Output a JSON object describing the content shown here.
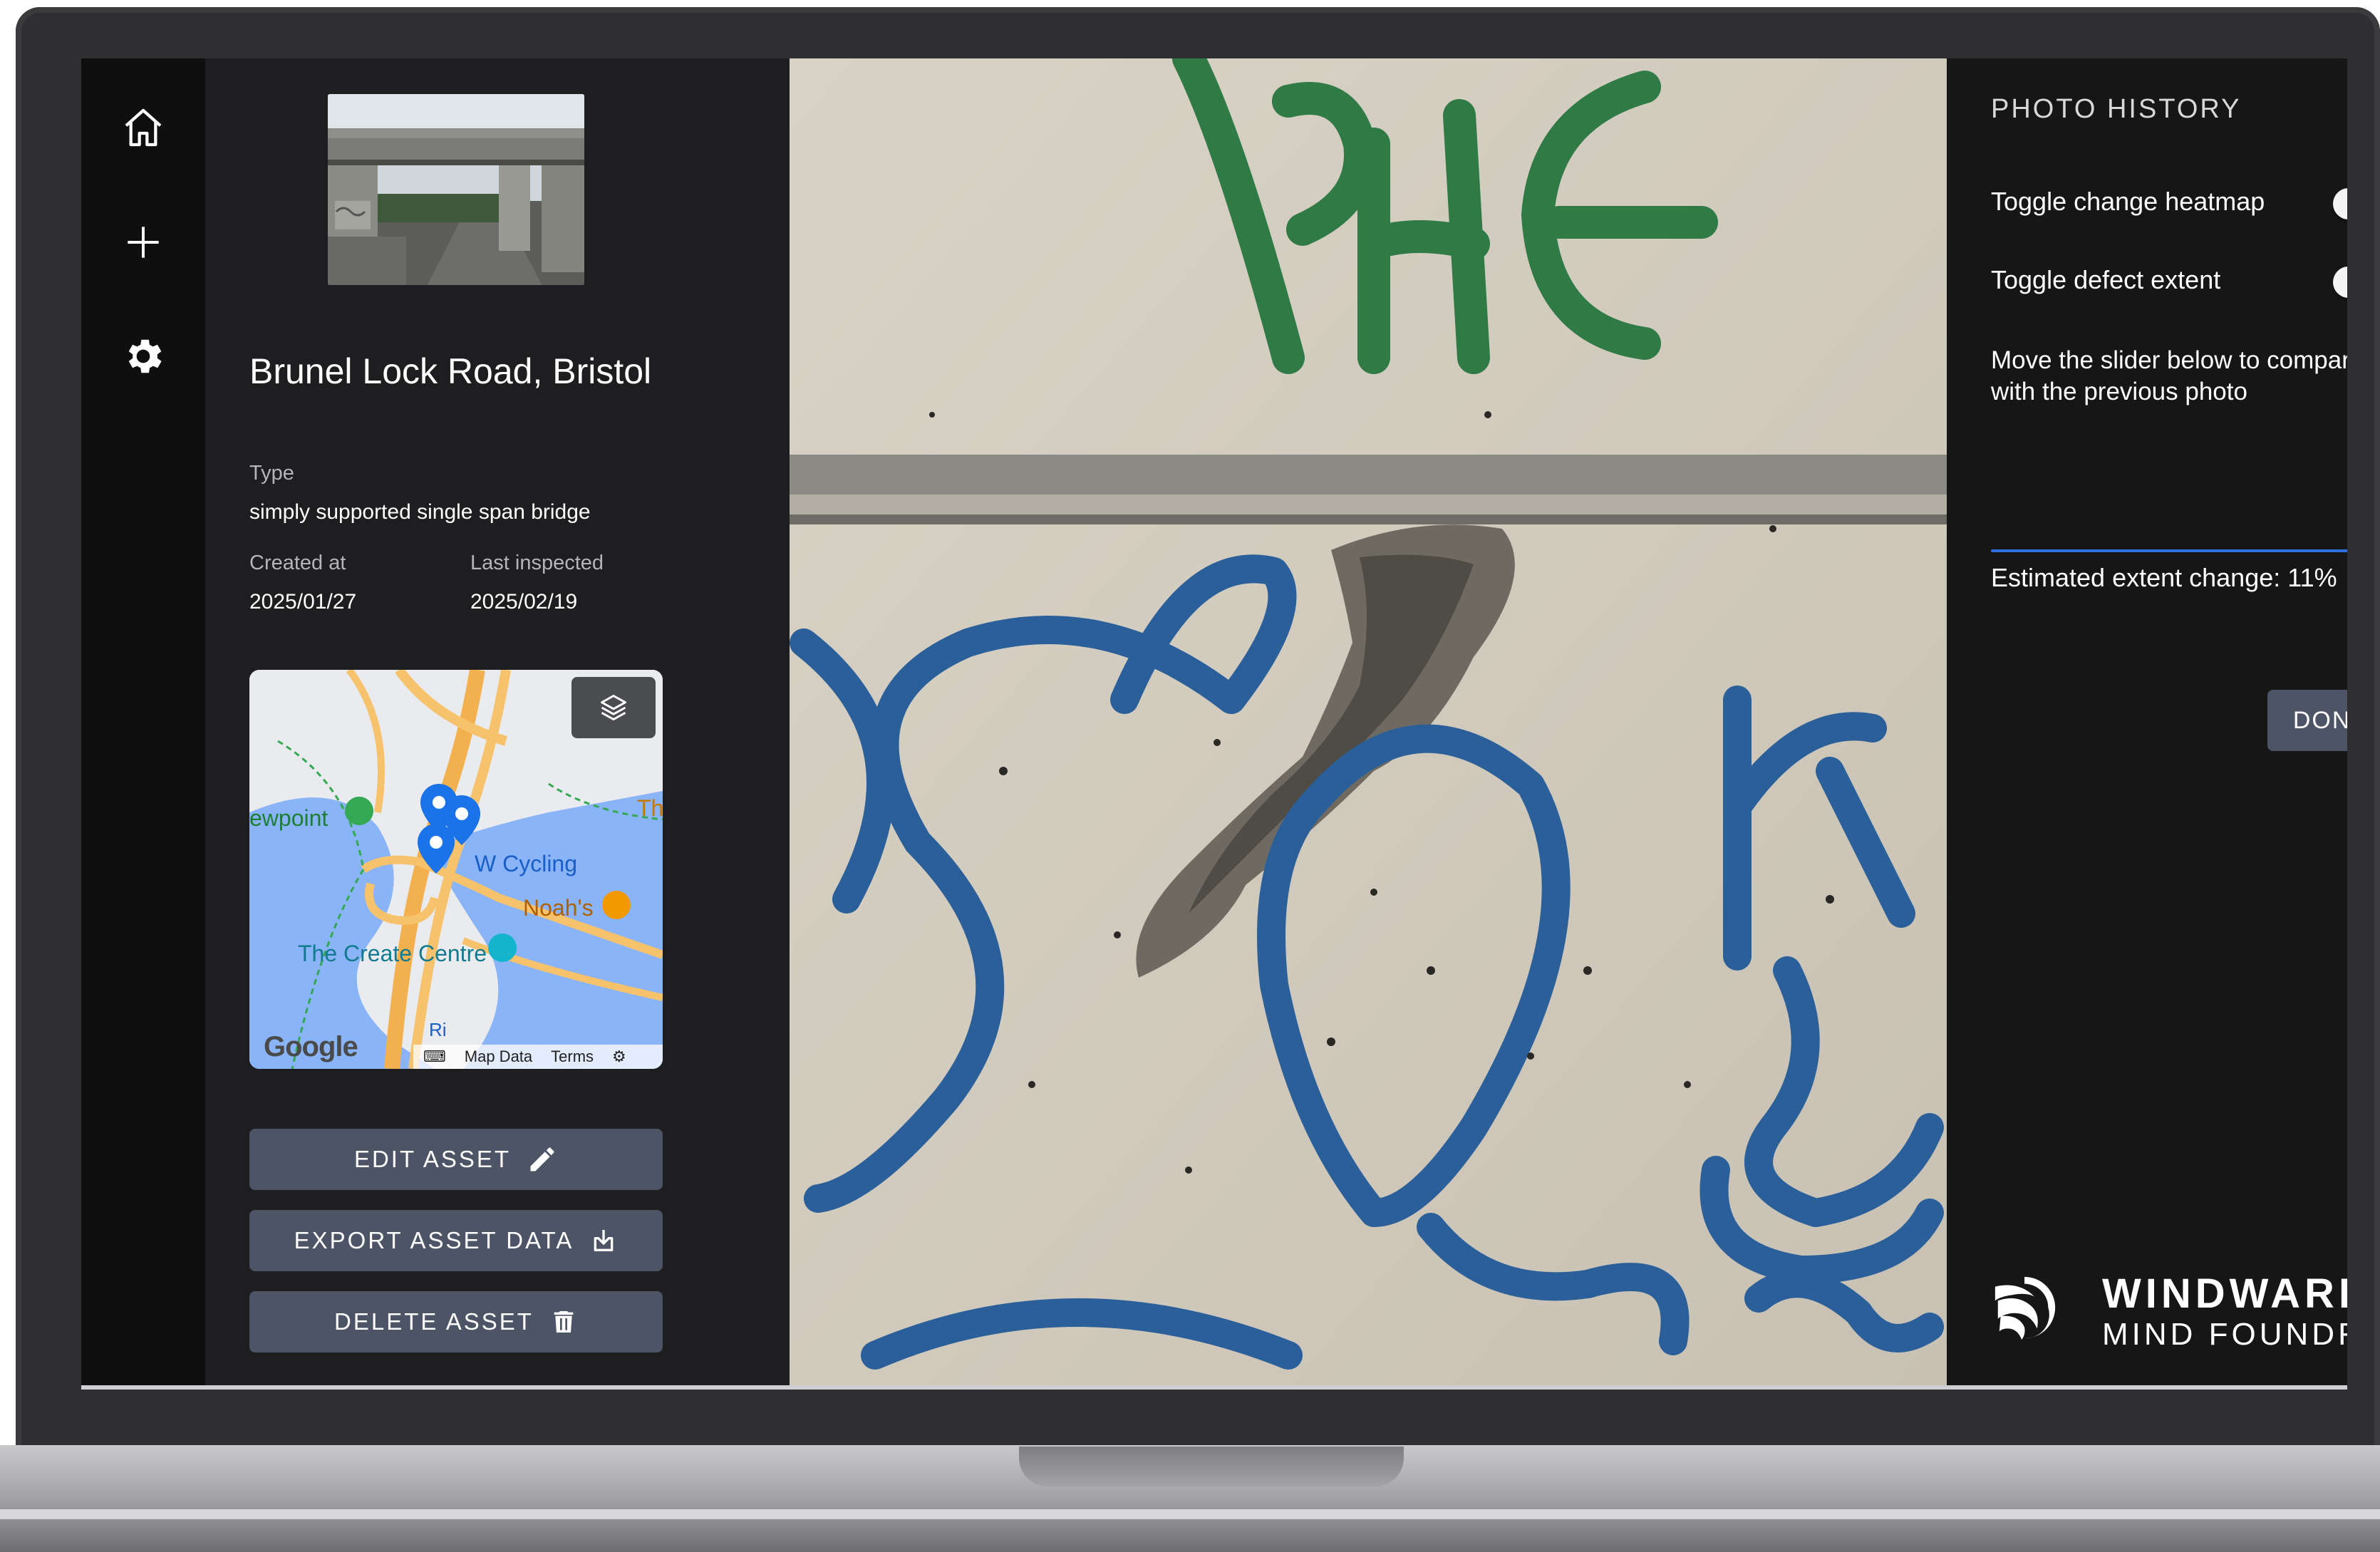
{
  "sidebar": {
    "icons": [
      "home-icon",
      "plus-icon",
      "gear-icon"
    ]
  },
  "asset": {
    "title": "Brunel Lock Road, Bristol",
    "type_label": "Type",
    "type_value": "simply supported single span bridge",
    "created_label": "Created at",
    "created_value": "2025/01/27",
    "inspected_label": "Last inspected",
    "inspected_value": "2025/02/19"
  },
  "map": {
    "labels": {
      "viewpoint": "ewpoint",
      "cycling": "W Cycling",
      "noahs": "Noah's",
      "create_centre": "The Create Centre",
      "th": "Th",
      "ri": "Ri"
    },
    "google": "Google",
    "map_data": "Map Data",
    "terms": "Terms"
  },
  "actions": {
    "edit": "EDIT ASSET",
    "export": "EXPORT ASSET DATA",
    "delete": "DELETE ASSET"
  },
  "history": {
    "title": "PHOTO HISTORY",
    "heatmap_label": "Toggle change heatmap",
    "heatmap_on": false,
    "defect_label": "Toggle defect extent",
    "defect_on": false,
    "instruction": "Move the slider below to compare with the previous photo",
    "slider_value": 1.0,
    "extent_text": "Estimated extent change: 11%",
    "done": "DONE"
  },
  "brand": {
    "name_top": "WINDWARD",
    "name_bottom": "MIND FOUNDRY"
  },
  "colors": {
    "accent_blue": "#2f6fe0",
    "button_bg": "#4c5466"
  }
}
